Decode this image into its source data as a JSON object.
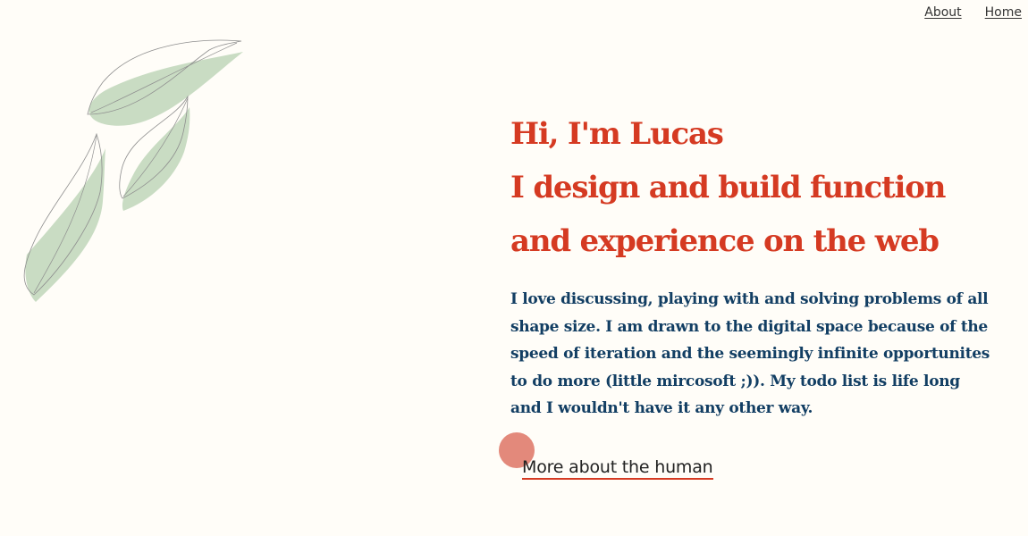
{
  "nav": {
    "items": [
      {
        "label": "About"
      },
      {
        "label": "Home"
      }
    ]
  },
  "hero": {
    "headline": [
      "Hi, I'm Lucas",
      "I design and build function",
      "and experience on the web"
    ],
    "intro": "I love discussing, playing with and solving problems of all shape size. I am drawn to the digital space because of the speed of iteration and the seemingly infinite opportunites to do more (little mircosoft ;)). My todo list is life long and I wouldn't have it any other way.",
    "cta_label": "More about the human"
  },
  "colors": {
    "background": "#fffdf8",
    "headline": "#d53a22",
    "body_text": "#123e63",
    "accent_dot": "#e3897b",
    "leaf_fill": "#c9dcc3"
  },
  "icons": {
    "decoration": "leaves-illustration-icon"
  }
}
